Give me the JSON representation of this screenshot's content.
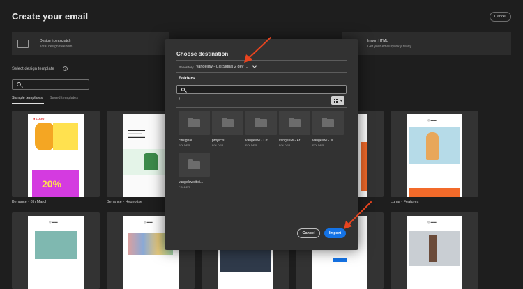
{
  "page": {
    "title": "Create your email",
    "cancel_label": "Cancel"
  },
  "options": [
    {
      "title": "Design from scratch",
      "subtitle": "Total design freedom"
    },
    {
      "title": "Import HTML",
      "subtitle": "Get your email quickly ready"
    }
  ],
  "templates_section": {
    "label": "Select design template",
    "tabs": [
      "Sample templates",
      "Saved templates"
    ],
    "cards": [
      {
        "name": "Behance - 8th March"
      },
      {
        "name": "Behance - Hypnotise"
      },
      {
        "name": "Luma - Features"
      }
    ]
  },
  "dialog": {
    "title": "Choose destination",
    "repository_label": "Repository",
    "repository_value": "vangeluw - Citi Signal 2 dev ...",
    "folders_heading": "Folders",
    "path": "/",
    "folders": [
      {
        "name": "citisignal",
        "type": "FOLDER"
      },
      {
        "name": "projects",
        "type": "FOLDER"
      },
      {
        "name": "vangeluw - Cit...",
        "type": "FOLDER"
      },
      {
        "name": "vangeluw - Fr...",
        "type": "FOLDER"
      },
      {
        "name": "vangeluw - W...",
        "type": "FOLDER"
      },
      {
        "name": "vangeluwcitisi...",
        "type": "FOLDER"
      }
    ],
    "cancel_label": "Cancel",
    "import_label": "Import"
  },
  "colors": {
    "background": "#1e1e1e",
    "dialog": "#323232",
    "accent": "#1473e6",
    "annotation": "#e8441f"
  }
}
